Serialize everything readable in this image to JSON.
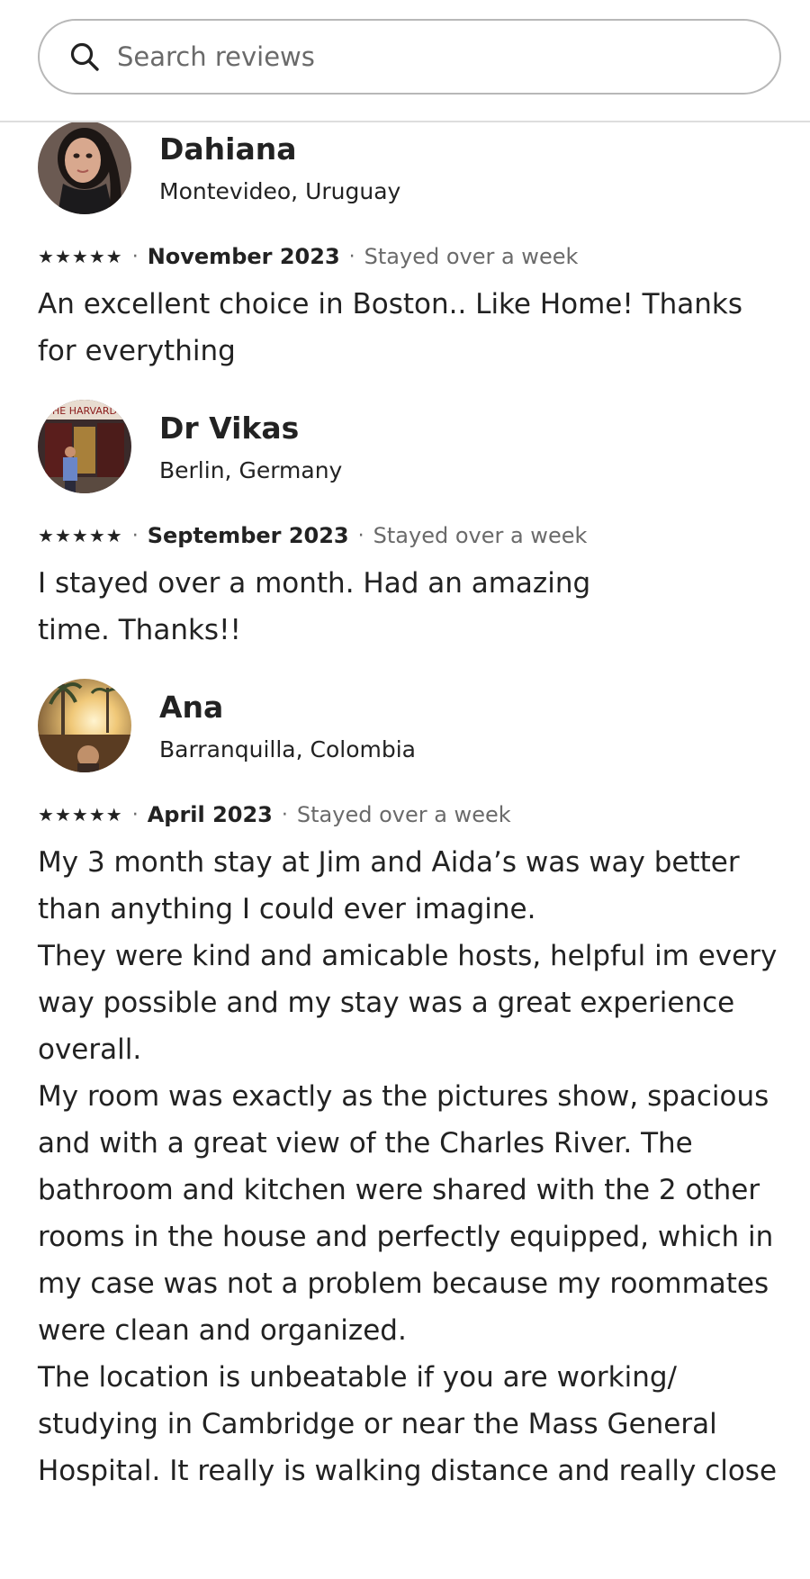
{
  "search": {
    "placeholder": "Search reviews",
    "icon": "search-icon"
  },
  "reviews": [
    {
      "name": "Dahiana",
      "location": "Montevideo, Uruguay",
      "rating": 5,
      "date": "November 2023",
      "stay": "Stayed over a week",
      "text": "An excellent choice in Boston.. Like Home! Thanks for everything"
    },
    {
      "name": "Dr Vikas",
      "location": "Berlin, Germany",
      "rating": 5,
      "date": "September 2023",
      "stay": "Stayed over a week",
      "text": "I stayed over a month. Had an amazing\ntime. Thanks!!"
    },
    {
      "name": "Ana",
      "location": "Barranquilla, Colombia",
      "rating": 5,
      "date": "April 2023",
      "stay": "Stayed over a week",
      "text": "My 3 month stay at Jim and Aida’s was way better than anything I could ever imagine.\nThey were kind and amicable hosts, helpful im every way possible and my stay was a great experience overall.\nMy room was exactly as the pictures show, spacious and with a great view of the Charles River. The bathroom and kitchen were shared with the 2 other rooms in the house and perfectly equipped, which in my case was not a problem because my roommates were clean and organized.\nThe location is unbeatable if you are working/ studying in Cambridge or near the Mass General Hospital. It really is walking distance and really close"
    }
  ],
  "star_glyph": "★",
  "separator": "·",
  "colors": {
    "text": "#222222",
    "secondary": "#6a6a6a",
    "border": "#b8b8b8"
  }
}
